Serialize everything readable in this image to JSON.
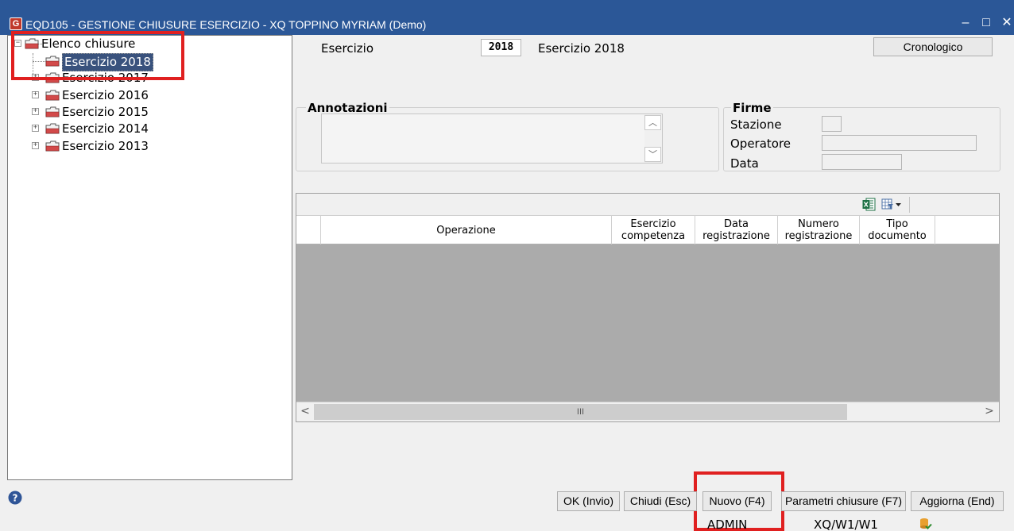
{
  "window": {
    "title": "EQD105 - GESTIONE CHIUSURE ESERCIZIO - XQ TOPPINO MYRIAM  (Demo)",
    "app_icon_glyph": "G",
    "minimize_glyph": "–",
    "maximize_glyph": "□",
    "close_glyph": "✕"
  },
  "tree": {
    "root_label": "Elenco chiusure",
    "items": [
      {
        "label": "Esercizio 2018",
        "selected": true
      },
      {
        "label": "Esercizio 2017",
        "selected": false
      },
      {
        "label": "Esercizio 2016",
        "selected": false
      },
      {
        "label": "Esercizio 2015",
        "selected": false
      },
      {
        "label": "Esercizio 2014",
        "selected": false
      },
      {
        "label": "Esercizio 2013",
        "selected": false
      }
    ]
  },
  "header": {
    "esercizio_label": "Esercizio",
    "esercizio_value": "2018",
    "esercizio_description": "Esercizio 2018",
    "cronologico_button": "Cronologico"
  },
  "annotazioni": {
    "title": "Annotazioni",
    "text": ""
  },
  "firme": {
    "title": "Firme",
    "stazione_label": "Stazione",
    "operatore_label": "Operatore",
    "data_label": "Data"
  },
  "grid": {
    "columns": [
      {
        "label": ""
      },
      {
        "label": "Operazione"
      },
      {
        "label": "Esercizio\ncompetenza"
      },
      {
        "label": "Data\nregistrazione"
      },
      {
        "label": "Numero\nregistrazione"
      },
      {
        "label": "Tipo\ndocumento"
      },
      {
        "label": ""
      }
    ],
    "rows": [],
    "hscroll_thumb_glyph": "III"
  },
  "buttons": {
    "ok": "OK (Invio)",
    "chiudi": "Chiudi (Esc)",
    "nuovo": "Nuovo (F4)",
    "parametri": "Parametri chiusure (F7)",
    "aggiorna": "Aggiorna (End)"
  },
  "status": {
    "user": "ADMIN",
    "station": "XQ/W1/W1"
  },
  "colors": {
    "titlebar": "#2b5797",
    "selection": "#39527d",
    "annotation_highlight": "#e02020",
    "grid_body": "#ababab"
  },
  "icons": {
    "help": "help-icon",
    "excel_export": "excel-icon",
    "filter_menu": "filter-dropdown-icon",
    "status": "db-status-icon"
  }
}
